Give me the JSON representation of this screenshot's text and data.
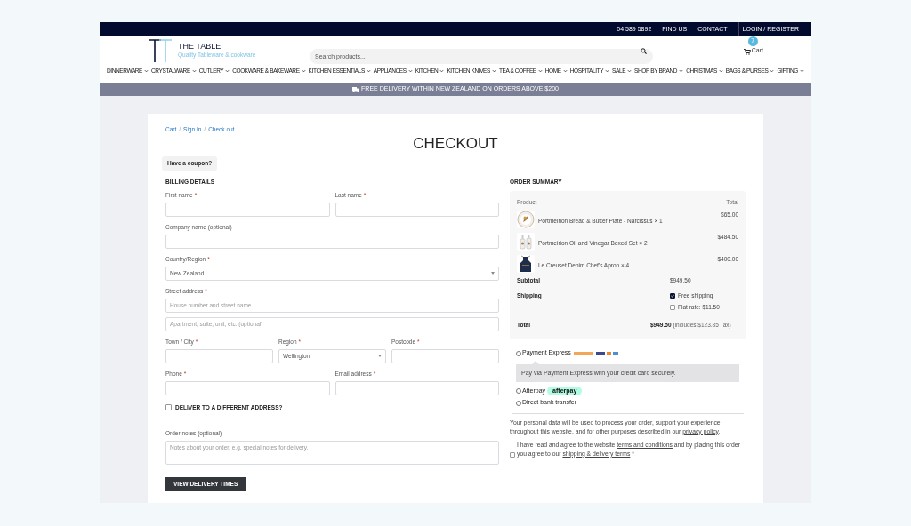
{
  "top_bar": {
    "links": [
      "04 589 5892",
      "FIND US",
      "CONTACT",
      "LOGIN / REGISTER"
    ]
  },
  "header": {
    "logo_title": "THE TABLE",
    "logo_tagline": "Quality Tableware & cookware",
    "search": {
      "placeholder": "Search products..."
    },
    "cart": {
      "count": "7",
      "label": "Cart"
    }
  },
  "nav": [
    "DINNERWARE",
    "CRYSTALWARE",
    "CUTLERY",
    "COOKWARE & BAKEWARE",
    "KITCHEN ESSENTIALS",
    "APPLIANCES",
    "KITCHEN",
    "KITCHEN KNIVES",
    "TEA & COFFEE",
    "HOME",
    "HOSPITALITY",
    "SALE",
    "SHOP BY BRAND",
    "CHRISTMAS",
    "BAGS & PURSES",
    "GIFTING"
  ],
  "banner": "FREE DELIVERY WITHIN NEW ZEALAND ON ORDERS ABOVE $200",
  "breadcrumbs": [
    "Cart",
    "Sign In",
    "Check out"
  ],
  "breadcrumb_separator": "/",
  "title": "CHECKOUT",
  "coupon": "Have a coupon?",
  "billing": {
    "heading": "BILLING DETAILS",
    "rows": [
      [
        {
          "label": "First name",
          "required_mark": "*",
          "kind": "input"
        },
        {
          "label": "Last name",
          "required_mark": "*",
          "kind": "input"
        }
      ],
      [
        {
          "label": "Company name (optional)",
          "kind": "input"
        }
      ],
      [
        {
          "label": "Country/Region",
          "required_mark": "*",
          "kind": "select",
          "value": "New Zealand"
        }
      ],
      [
        {
          "label": "Street address",
          "required_mark": "*",
          "kind": "input",
          "placeholder": "House number and street name"
        }
      ],
      [
        {
          "kind": "input",
          "placeholder": "Apartment, suite, unit, etc. (optional)"
        }
      ],
      [
        {
          "label": "Town / City",
          "required_mark": "*",
          "kind": "input"
        },
        {
          "label": "Region",
          "required_mark": "*",
          "kind": "select",
          "value": "Wellington"
        },
        {
          "label": "Postcode",
          "required_mark": "*",
          "kind": "input"
        }
      ],
      [
        {
          "label": "Phone",
          "required_mark": "*",
          "kind": "input"
        },
        {
          "label": "Email address",
          "required_mark": "*",
          "kind": "input"
        }
      ]
    ],
    "different_address": {
      "label": "DELIVER TO A DIFFERENT ADDRESS?",
      "checked": false
    },
    "notes": {
      "label": "Order notes (optional)",
      "placeholder": "Notes about your order, e.g. special notes for delivery."
    },
    "button": "VIEW DELIVERY TIMES"
  },
  "summary": {
    "heading": "ORDER SUMMARY",
    "columns": [
      "Product",
      "Total"
    ],
    "items": [
      {
        "kind": "plate",
        "name": "Portmeirion Bread & Butter Plate - Narcissus",
        "qty": "× 1",
        "total": "$65.00"
      },
      {
        "kind": "bottles",
        "name": "Portmeirion Oil and Vinegar Boxed Set",
        "qty": "× 2",
        "total": "$484.50"
      },
      {
        "kind": "apron",
        "name": "Le Creuset Denim Chef's Apron",
        "qty": "× 4",
        "total": "$400.00"
      }
    ],
    "subtotal": {
      "label": "Subtotal",
      "value": "$949.50"
    },
    "shipping": {
      "label": "Shipping",
      "options": [
        {
          "label": "Free shipping",
          "checked": true
        },
        {
          "label": "Flat rate: $11.50",
          "checked": false
        }
      ]
    },
    "total": {
      "label": "Total",
      "value": "$949.50",
      "note": "(includes $123.85 Tax)"
    }
  },
  "payment": {
    "methods": [
      {
        "label": "Payment Express",
        "selected": false,
        "kind": "cards",
        "description": "Pay via Payment Express with your credit card securely."
      },
      {
        "label": "Afterpay",
        "selected": false,
        "kind": "afterpay",
        "badge": "afterpay"
      },
      {
        "label": "Direct bank transfer",
        "selected": false,
        "kind": "plain"
      }
    ]
  },
  "privacy": {
    "text": "Your personal data will be used to process your order, support your experience throughout this website, and for other purposes described in our ",
    "link": "privacy policy",
    "end": "."
  },
  "terms": {
    "checked": false,
    "before": "I have read and agree to the website ",
    "link1": "terms and conditions",
    "middle": " and by placing this order you agree to our ",
    "link2": "shipping & delivery terms",
    "mark": "*"
  }
}
